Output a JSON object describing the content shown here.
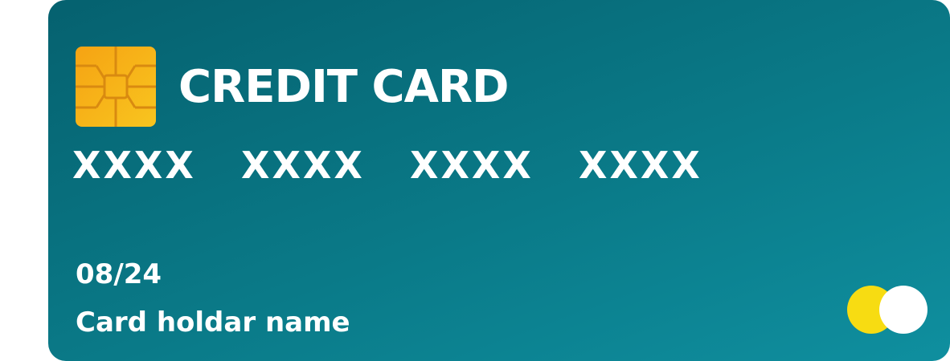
{
  "card": {
    "title": "CREDIT CARD",
    "number_groups": [
      "XXXX",
      "XXXX",
      "XXXX",
      "XXXX"
    ],
    "expiry": "08/24",
    "holder_name": "Card holdar name",
    "logo_icon": "two-circles-logo-icon",
    "chip_icon": "chip-icon"
  },
  "colors": {
    "card_gradient_start": "#05616f",
    "card_gradient_end": "#0f8f9f",
    "chip_gold": "#f6b21c",
    "logo_left_circle": "#f7dc12",
    "logo_right_circle": "#ffffff",
    "text": "#ffffff"
  }
}
